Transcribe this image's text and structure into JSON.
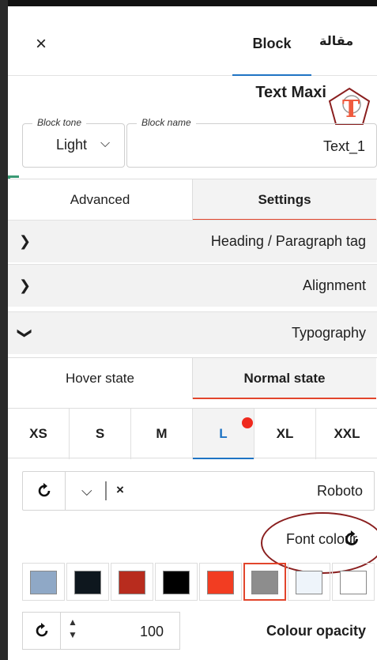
{
  "header": {
    "close_icon": "close-icon",
    "tab_block": "Block",
    "tab_article": "مقالة"
  },
  "block": {
    "title": "Text Maxi",
    "icon": "text-maxi-icon",
    "tone_legend": "Block tone",
    "tone_value": "Light",
    "name_legend": "Block name",
    "name_value": "Text_1"
  },
  "top_tabs": {
    "left": "Advanced",
    "right": "Settings"
  },
  "accordion": [
    {
      "label": "Heading / Paragraph tag",
      "state": "collapsed"
    },
    {
      "label": "Alignment",
      "state": "collapsed"
    },
    {
      "label": "Typography",
      "state": "expanded"
    }
  ],
  "state_tabs": {
    "left": "Hover state",
    "right": "Normal state"
  },
  "sizes": {
    "items": [
      "XS",
      "S",
      "M",
      "L",
      "XL",
      "XXL"
    ],
    "active": "L"
  },
  "font": {
    "name": "Roboto",
    "reset_icon": "reset-icon",
    "clear_icon": "close-icon"
  },
  "font_colour": {
    "label": "Font colour"
  },
  "swatches": {
    "colors": [
      "#8FA8C6",
      "#0E171E",
      "#B82C1E",
      "#000000",
      "#F23D22",
      "#8D8D8D",
      "#EEF4FA",
      "#FFFFFF"
    ],
    "selected": 5
  },
  "opacity": {
    "value": "100",
    "label": "Colour opacity"
  },
  "colors": {
    "accent_blue": "#1F74C4",
    "accent_red": "#E2452C"
  }
}
